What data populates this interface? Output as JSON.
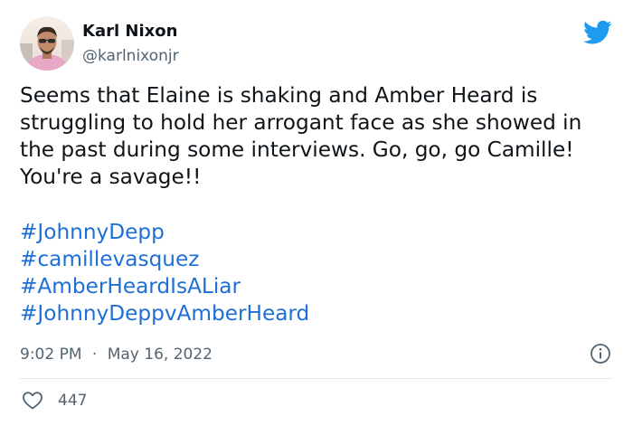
{
  "author": {
    "display_name": "Karl Nixon",
    "handle": "@karlnixonjr"
  },
  "tweet": {
    "text": "Seems that Elaine is shaking and Amber Heard is struggling to hold her arrogant face as she showed in the past during some interviews. Go, go, go Camille! You're a savage!!",
    "hashtags": [
      "#JohnnyDepp",
      "#camillevasquez",
      "#AmberHeardIsALiar",
      "#JohnnyDeppvAmberHeard"
    ]
  },
  "meta": {
    "time": "9:02 PM",
    "separator": "·",
    "date": "May 16, 2022"
  },
  "actions": {
    "like_count": "447"
  },
  "icons": {
    "brand": "twitter-bird-icon",
    "info": "info-icon",
    "like": "heart-icon"
  },
  "colors": {
    "brand_blue": "#1d9bf0",
    "hashtag_blue": "#1d6fd6",
    "secondary_text": "#536471",
    "primary_text": "#0f1419"
  }
}
